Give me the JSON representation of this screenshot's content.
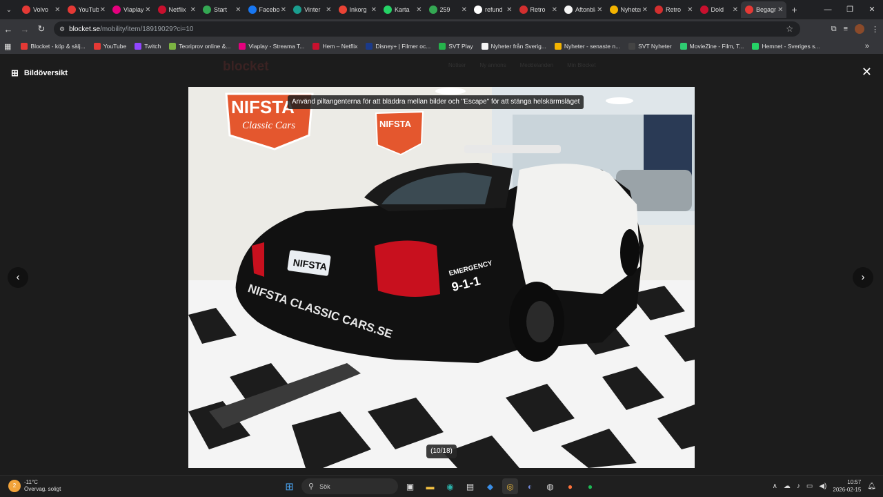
{
  "tabs": [
    {
      "label": "Volvo",
      "color": "#e53935",
      "active": false
    },
    {
      "label": "YouTube",
      "color": "#e53935",
      "active": false
    },
    {
      "label": "Viaplay",
      "color": "#e5007e",
      "active": false
    },
    {
      "label": "Netflix",
      "color": "#c8102e",
      "active": false
    },
    {
      "label": "Start",
      "color": "#34a853",
      "active": false
    },
    {
      "label": "Facebook",
      "color": "#1877f2",
      "active": false
    },
    {
      "label": "Vinter",
      "color": "#1a9e8f",
      "active": false
    },
    {
      "label": "Inkorg",
      "color": "#ea4335",
      "active": false
    },
    {
      "label": "Karta",
      "color": "#25d366",
      "active": false
    },
    {
      "label": "259",
      "color": "#34a853",
      "active": false
    },
    {
      "label": "refund",
      "color": "#ffffff",
      "active": false
    },
    {
      "label": "Retro",
      "color": "#d32f2f",
      "active": false
    },
    {
      "label": "Aftonbladet",
      "color": "#f5f5f5",
      "active": false
    },
    {
      "label": "Nyheter",
      "color": "#f4b400",
      "active": false
    },
    {
      "label": "Retro",
      "color": "#d32f2f",
      "active": false
    },
    {
      "label": "Dold",
      "color": "#c8102e",
      "active": false
    },
    {
      "label": "Begagnat",
      "color": "#e53935",
      "active": true
    }
  ],
  "address": {
    "host": "blocket.se",
    "path": "/mobility/item/18919029?ci=10"
  },
  "bookmarks": [
    {
      "label": "Blocket - köp & sälj...",
      "color": "#e53935"
    },
    {
      "label": "YouTube",
      "color": "#e53935"
    },
    {
      "label": "Twitch",
      "color": "#9146ff"
    },
    {
      "label": "Teoriprov online &...",
      "color": "#7cb342"
    },
    {
      "label": "Viaplay - Streama T...",
      "color": "#e5007e"
    },
    {
      "label": "Hem – Netflix",
      "color": "#c8102e"
    },
    {
      "label": "Disney+ | Filmer oc...",
      "color": "#1b3a8a"
    },
    {
      "label": "SVT Play",
      "color": "#25b34b"
    },
    {
      "label": "Nyheter från Sverig...",
      "color": "#f5f5f5"
    },
    {
      "label": "Nyheter - senaste n...",
      "color": "#f4b400"
    },
    {
      "label": "SVT Nyheter",
      "color": "#444444"
    },
    {
      "label": "MovieZine - Film, T...",
      "color": "#2ecc71"
    },
    {
      "label": "Hemnet - Sveriges s...",
      "color": "#25d366"
    }
  ],
  "viewer": {
    "title": "Bildöversikt",
    "hint": "Använd piltangenterna för att bläddra mellan bilder och \"Escape\" för att stänga helskärmsläget",
    "counter": "(10/18)",
    "ghost_logo": "blocket",
    "ghost_nav": [
      "Notiser",
      "Ny annons",
      "Meddelanden",
      "Min Blocket"
    ]
  },
  "photo": {
    "sign_main": "NIFSTA",
    "sign_sub": "Classic Cars",
    "plate": "NIFSTA",
    "rear_text": "NIFSTA CLASSIC CARS.SE",
    "decal_top": "EMERGENCY",
    "decal_num": "9-1-1"
  },
  "taskbar": {
    "temp": "-11°C",
    "condition": "Övervag. soligt",
    "search_placeholder": "Sök",
    "time": "10:57",
    "date": "2026-02-15",
    "weather_badge": "2"
  }
}
